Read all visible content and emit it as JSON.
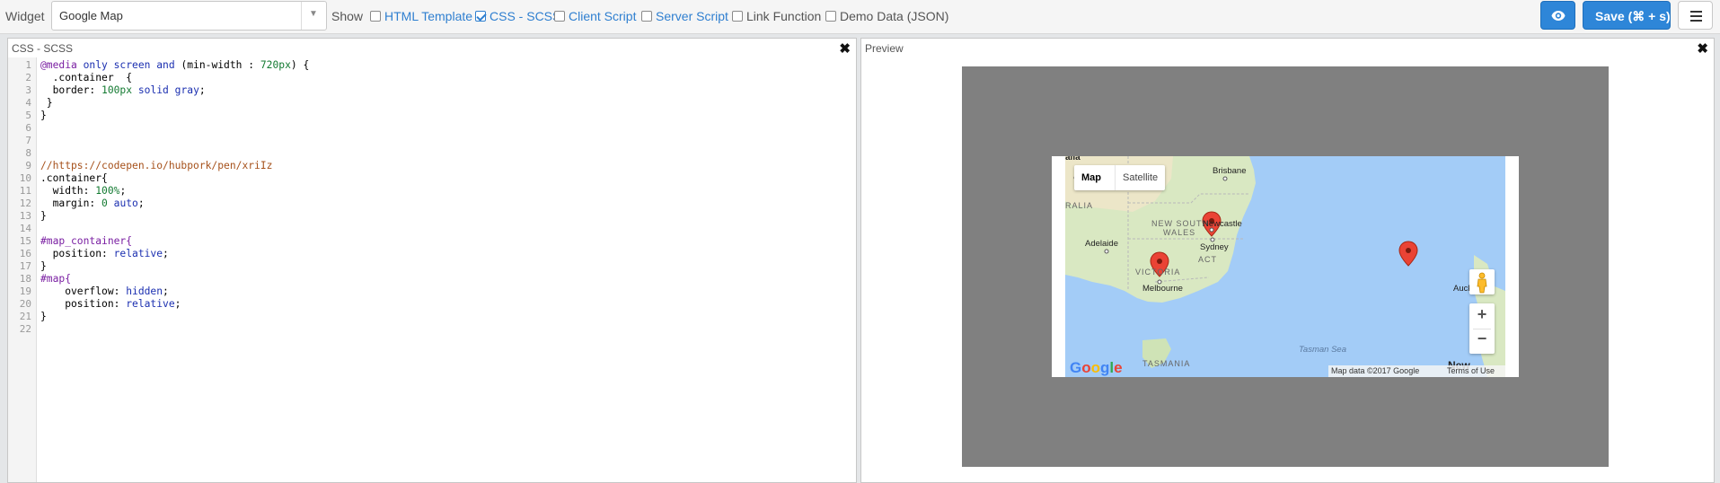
{
  "toolbar": {
    "widget_label": "Widget",
    "widget_value": "Google Map",
    "show_label": "Show",
    "options": [
      {
        "label": "HTML Template",
        "checked": false,
        "style": "link"
      },
      {
        "label": "CSS - SCSS",
        "checked": true,
        "style": "link"
      },
      {
        "label": "Client Script",
        "checked": false,
        "style": "link"
      },
      {
        "label": "Server Script",
        "checked": false,
        "style": "link"
      },
      {
        "label": "Link Function",
        "checked": false,
        "style": "plain"
      },
      {
        "label": "Demo Data (JSON)",
        "checked": false,
        "style": "plain"
      }
    ],
    "save_label": "Save (⌘ + s)",
    "preview_icon": "eye-icon",
    "menu_icon": "hamburger-icon"
  },
  "css_panel": {
    "title": "CSS - SCSS",
    "close_glyph": "✖",
    "lines": [
      "1",
      "2",
      "3",
      "4",
      "5",
      "6",
      "7",
      "8",
      "9",
      "10",
      "11",
      "12",
      "13",
      "14",
      "15",
      "16",
      "17",
      "18",
      "19",
      "20",
      "21",
      "22"
    ],
    "code": {
      "l1a": "@media",
      "l1b": " only ",
      "l1c": "screen",
      "l1d": " and ",
      "l1e": "(min-width : ",
      "l1f": "720px",
      "l1g": ") {",
      "l2": "  .container  {",
      "l3a": "  border: ",
      "l3b": "100px",
      "l3c": " ",
      "l3d": "solid",
      "l3e": " ",
      "l3f": "gray",
      "l3g": ";",
      "l4": " }",
      "l5": "}",
      "l9": "//https://codepen.io/hubpork/pen/xriIz",
      "l10": ".container{",
      "l11a": "  width: ",
      "l11b": "100%",
      "l11c": ";",
      "l12a": "  margin: ",
      "l12b": "0",
      "l12c": " ",
      "l12d": "auto",
      "l12e": ";",
      "l13": "}",
      "l15": "#map_container{",
      "l16a": "  position: ",
      "l16b": "relative",
      "l16c": ";",
      "l17": "}",
      "l18": "#map{",
      "l19a": "    overflow: ",
      "l19b": "hidden",
      "l19c": ";",
      "l20a": "    position: ",
      "l20b": "relative",
      "l20c": ";",
      "l21": "}"
    }
  },
  "preview_panel": {
    "title": "Preview",
    "close_glyph": "✖",
    "map": {
      "type_map": "Map",
      "type_satellite": "Satellite",
      "places": {
        "brisbane": "Brisbane",
        "newcastle": "Newcastle",
        "sydney": "Sydney",
        "nsw1": "NEW SOUTH",
        "nsw2": "WALES",
        "adelaide": "Adelaide",
        "act": "ACT",
        "victoria": "VICTORIA",
        "melbourne": "Melbourne",
        "tasman": "Tasman Sea",
        "tasmania": "TASMANIA",
        "auckland": "Auckland",
        "ralia": "RALIA",
        "aus": "alia",
        "new": "New"
      },
      "zoom_in": "+",
      "zoom_out": "−",
      "logo": "Google",
      "map_data": "Map data ©2017 Google",
      "terms": "Terms of Use"
    }
  }
}
